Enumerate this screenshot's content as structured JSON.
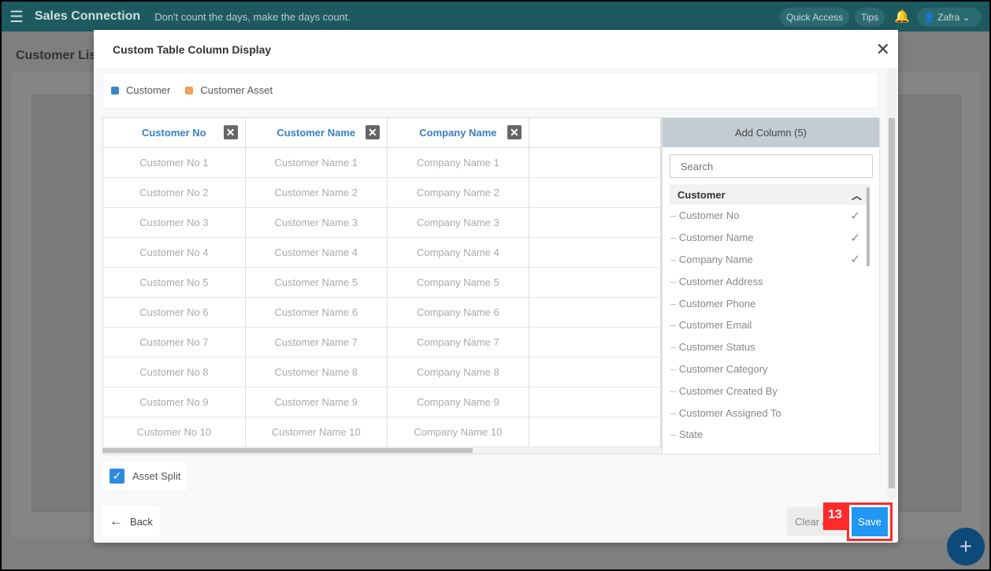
{
  "topbar": {
    "brand": "Sales Connection",
    "tagline": "Don't count the days, make the days count.",
    "quick_access": "Quick Access",
    "tips": "Tips",
    "user": "Zafra"
  },
  "background": {
    "title": "Customer Lis"
  },
  "modal": {
    "title": "Custom Table Column Display",
    "legend": [
      {
        "label": "Customer",
        "color": "#3a86c8"
      },
      {
        "label": "Customer Asset",
        "color": "#f0a05a"
      }
    ],
    "columns": [
      "Customer No",
      "Customer Name",
      "Company Name"
    ],
    "rows": [
      [
        "Customer No 1",
        "Customer Name 1",
        "Company Name 1"
      ],
      [
        "Customer No 2",
        "Customer Name 2",
        "Company Name 2"
      ],
      [
        "Customer No 3",
        "Customer Name 3",
        "Company Name 3"
      ],
      [
        "Customer No 4",
        "Customer Name 4",
        "Company Name 4"
      ],
      [
        "Customer No 5",
        "Customer Name 5",
        "Company Name 5"
      ],
      [
        "Customer No 6",
        "Customer Name 6",
        "Company Name 6"
      ],
      [
        "Customer No 7",
        "Customer Name 7",
        "Company Name 7"
      ],
      [
        "Customer No 8",
        "Customer Name 8",
        "Company Name 8"
      ],
      [
        "Customer No 9",
        "Customer Name 9",
        "Company Name 9"
      ],
      [
        "Customer No 10",
        "Customer Name 10",
        "Company Name 10"
      ]
    ],
    "add_column": {
      "title": "Add Column (5)",
      "search_placeholder": "Search",
      "group": "Customer",
      "items": [
        {
          "label": "Customer No",
          "checked": true
        },
        {
          "label": "Customer Name",
          "checked": true
        },
        {
          "label": "Company Name",
          "checked": true
        },
        {
          "label": "Customer Address",
          "checked": false
        },
        {
          "label": "Customer Phone",
          "checked": false
        },
        {
          "label": "Customer Email",
          "checked": false
        },
        {
          "label": "Customer Status",
          "checked": false
        },
        {
          "label": "Customer Category",
          "checked": false
        },
        {
          "label": "Customer Created By",
          "checked": false
        },
        {
          "label": "Customer Assigned To",
          "checked": false
        },
        {
          "label": "State",
          "checked": false
        }
      ]
    },
    "asset_split": {
      "label": "Asset Split",
      "checked": true
    },
    "back": "Back",
    "clear": "Clear A",
    "save": "Save",
    "step_badge": "13"
  }
}
